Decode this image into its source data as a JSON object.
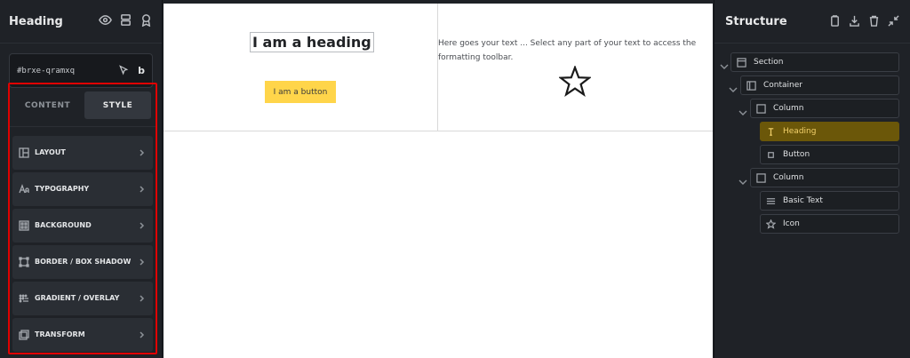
{
  "left_panel": {
    "title": "Heading",
    "element_id": "#brxe-qramxq",
    "id_suffix": "b",
    "tabs": [
      {
        "label": "CONTENT",
        "active": false
      },
      {
        "label": "STYLE",
        "active": true
      }
    ],
    "groups": [
      {
        "label": "LAYOUT",
        "icon": "layout-icon"
      },
      {
        "label": "TYPOGRAPHY",
        "icon": "typography-icon"
      },
      {
        "label": "BACKGROUND",
        "icon": "background-icon"
      },
      {
        "label": "BORDER / BOX SHADOW",
        "icon": "border-icon"
      },
      {
        "label": "GRADIENT / OVERLAY",
        "icon": "gradient-icon"
      },
      {
        "label": "TRANSFORM",
        "icon": "transform-icon"
      }
    ]
  },
  "canvas": {
    "heading_text": "I am a heading",
    "button_text": "I am a button",
    "basic_text": "Here goes your text ... Select any part of your text to access the formatting toolbar.",
    "button_color": "#ffd54a"
  },
  "structure_panel": {
    "title": "Structure",
    "nodes": [
      {
        "label": "Section",
        "icon": "section-icon"
      },
      {
        "label": "Container",
        "icon": "container-icon"
      },
      {
        "label": "Column",
        "icon": "column-icon"
      },
      {
        "label": "Heading",
        "icon": "heading-icon",
        "active": true
      },
      {
        "label": "Button",
        "icon": "button-icon"
      },
      {
        "label": "Column",
        "icon": "column-icon"
      },
      {
        "label": "Basic Text",
        "icon": "basic-text-icon"
      },
      {
        "label": "Icon",
        "icon": "star-icon"
      }
    ],
    "active_color": "#6b5709"
  }
}
